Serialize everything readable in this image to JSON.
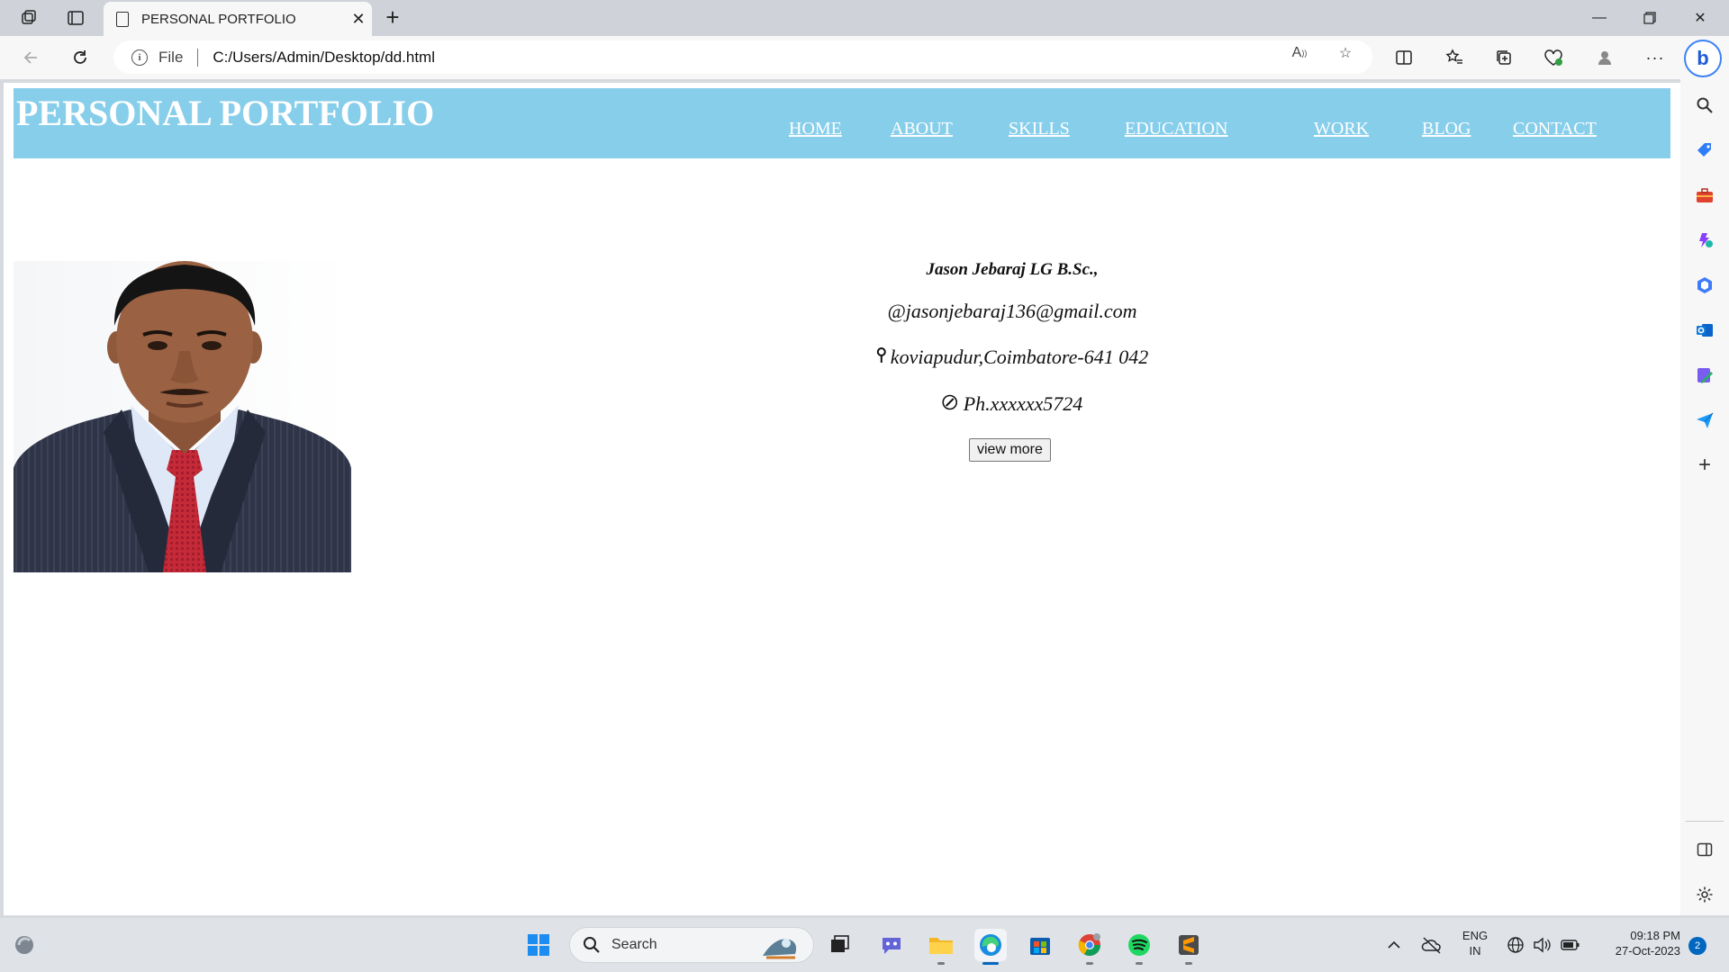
{
  "browser": {
    "tab_title": "PERSONAL PORTFOLIO",
    "address": {
      "scheme_label": "File",
      "url": "C:/Users/Admin/Desktop/dd.html"
    }
  },
  "page": {
    "site_title": "PERSONAL PORTFOLIO",
    "nav": [
      "HOME",
      "ABOUT",
      "SKILLS",
      "EDUCATION",
      "WORK",
      "BLOG",
      "CONTACT"
    ],
    "profile": {
      "name": "Jason Jebaraj LG B.Sc.,",
      "email": "@jasonjebaraj136@gmail.com",
      "address": "koviapudur,Coimbatore-641 042",
      "phone": "Ph.xxxxxx5724",
      "button_label": "view more"
    },
    "colors": {
      "header_bg": "#87ceeb",
      "header_text": "#ffffff"
    }
  },
  "taskbar": {
    "search_label": "Search",
    "language": "ENG",
    "region": "IN",
    "time": "09:18 PM",
    "date": "27-Oct-2023",
    "notification_count": "2"
  }
}
